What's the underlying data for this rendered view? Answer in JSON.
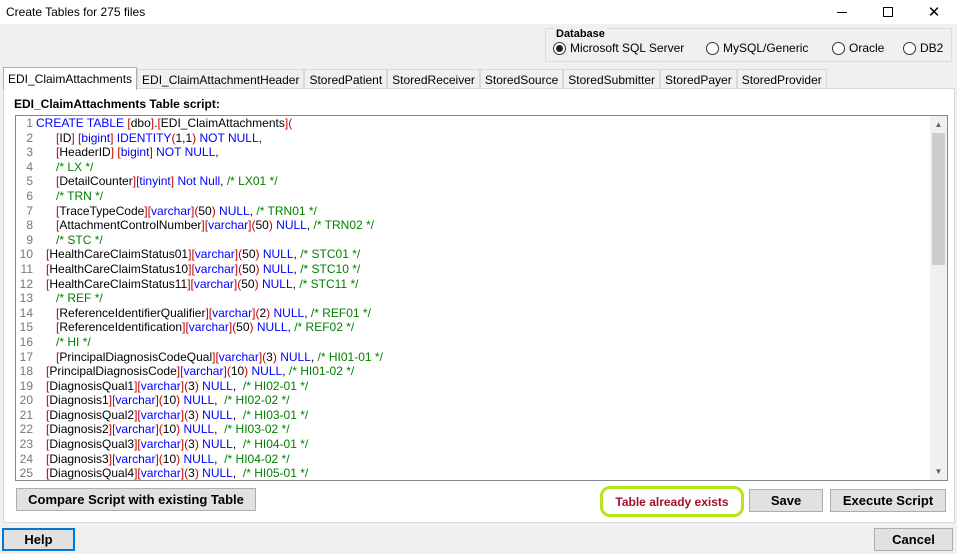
{
  "window": {
    "title": "Create Tables for 275 files",
    "minimize_symbol": "—",
    "maximize_symbol": "☐",
    "close_symbol": "✕"
  },
  "database": {
    "legend": "Database",
    "options": [
      {
        "label": "Microsoft SQL Server",
        "selected": true
      },
      {
        "label": "MySQL/Generic",
        "selected": false
      },
      {
        "label": "Oracle",
        "selected": false
      },
      {
        "label": "DB2",
        "selected": false
      }
    ]
  },
  "tabs": [
    {
      "label": "EDI_ClaimAttachments",
      "active": true
    },
    {
      "label": "EDI_ClaimAttachmentHeader",
      "active": false
    },
    {
      "label": "StoredPatient",
      "active": false
    },
    {
      "label": "StoredReceiver",
      "active": false
    },
    {
      "label": "StoredSource",
      "active": false
    },
    {
      "label": "StoredSubmitter",
      "active": false
    },
    {
      "label": "StoredPayer",
      "active": false
    },
    {
      "label": "StoredProvider",
      "active": false
    }
  ],
  "script_label": "EDI_ClaimAttachments Table script:",
  "script_lines": [
    {
      "n": "1",
      "t": "CREATE TABLE [dbo].[EDI_ClaimAttachments]("
    },
    {
      "n": "2",
      "t": "      [ID] [bigint] IDENTITY(1,1) NOT NULL,"
    },
    {
      "n": "3",
      "t": "      [HeaderID] [bigint] NOT NULL,"
    },
    {
      "n": "4",
      "t": "      /* LX */"
    },
    {
      "n": "5",
      "t": "      [DetailCounter][tinyint] Not Null, /* LX01 */"
    },
    {
      "n": "6",
      "t": "      /* TRN */"
    },
    {
      "n": "7",
      "t": "      [TraceTypeCode][varchar](50) NULL, /* TRN01 */"
    },
    {
      "n": "8",
      "t": "      [AttachmentControlNumber][varchar](50) NULL, /* TRN02 */"
    },
    {
      "n": "9",
      "t": "      /* STC */"
    },
    {
      "n": "10",
      "t": "   [HealthCareClaimStatus01][varchar](50) NULL, /* STC01 */"
    },
    {
      "n": "11",
      "t": "   [HealthCareClaimStatus10][varchar](50) NULL, /* STC10 */"
    },
    {
      "n": "12",
      "t": "   [HealthCareClaimStatus11][varchar](50) NULL, /* STC11 */"
    },
    {
      "n": "13",
      "t": "      /* REF */"
    },
    {
      "n": "14",
      "t": "      [ReferenceIdentifierQualifier][varchar](2) NULL, /* REF01 */"
    },
    {
      "n": "15",
      "t": "      [ReferenceIdentification][varchar](50) NULL, /* REF02 */"
    },
    {
      "n": "16",
      "t": "      /* HI */"
    },
    {
      "n": "17",
      "t": "      [PrincipalDiagnosisCodeQual][varchar](3) NULL, /* HI01-01 */"
    },
    {
      "n": "18",
      "t": "   [PrincipalDiagnosisCode][varchar](10) NULL, /* HI01-02 */"
    },
    {
      "n": "19",
      "t": "   [DiagnosisQual1][varchar](3) NULL,  /* HI02-01 */"
    },
    {
      "n": "20",
      "t": "   [Diagnosis1][varchar](10) NULL,  /* HI02-02 */"
    },
    {
      "n": "21",
      "t": "   [DiagnosisQual2][varchar](3) NULL,  /* HI03-01 */"
    },
    {
      "n": "22",
      "t": "   [Diagnosis2][varchar](10) NULL,  /* HI03-02 */"
    },
    {
      "n": "23",
      "t": "   [DiagnosisQual3][varchar](3) NULL,  /* HI04-01 */"
    },
    {
      "n": "24",
      "t": "   [Diagnosis3][varchar](10) NULL,  /* HI04-02 */"
    },
    {
      "n": "25",
      "t": "   [DiagnosisQual4][varchar](3) NULL,  /* HI05-01 */"
    }
  ],
  "buttons": {
    "compare": "Compare Script with existing Table",
    "status": "Table already exists",
    "save": "Save",
    "execute": "Execute Script",
    "help": "Help",
    "cancel": "Cancel"
  },
  "colors": {
    "keyword": "#0000ff",
    "bracket": "#c00000",
    "comment": "#008000",
    "status_text": "#a0102a",
    "status_highlight": "#b5e61d",
    "focus_border": "#0078d7"
  },
  "icons": {
    "scroll_up": "▲",
    "scroll_down": "▼"
  }
}
